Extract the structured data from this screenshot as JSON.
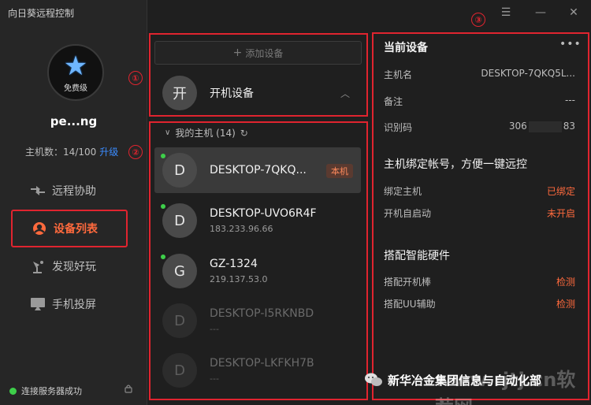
{
  "app": {
    "title": "向日葵远程控制"
  },
  "sidebar": {
    "avatar_tier": "免费级",
    "username": "pe...ng",
    "host_count": "主机数：14/100",
    "upgrade_label": "升级",
    "nav": [
      {
        "label": "远程协助",
        "icon": "remote-assist-icon"
      },
      {
        "label": "设备列表",
        "icon": "device-list-icon"
      },
      {
        "label": "发现好玩",
        "icon": "discover-icon"
      },
      {
        "label": "手机投屏",
        "icon": "screen-cast-icon"
      }
    ],
    "status": "连接服务器成功"
  },
  "badges": [
    "①",
    "②",
    "③"
  ],
  "middle": {
    "add_device": "添加设备",
    "power_device": {
      "avatar": "开",
      "label": "开机设备"
    },
    "group": {
      "label": "我的主机 (14)"
    },
    "devices": [
      {
        "initial": "D",
        "name": "DESKTOP-7QKQ...",
        "ip": "",
        "tag": "本机",
        "online": true
      },
      {
        "initial": "D",
        "name": "DESKTOP-UVO6R4F",
        "ip": "183.233.96.66",
        "online": true
      },
      {
        "initial": "G",
        "name": "GZ-1324",
        "ip": "219.137.53.0",
        "online": true
      },
      {
        "initial": "D",
        "name": "DESKTOP-I5RKNBD",
        "ip": "---",
        "online": false
      },
      {
        "initial": "D",
        "name": "DESKTOP-LKFKH7B",
        "ip": "---",
        "online": false
      }
    ]
  },
  "right": {
    "title": "当前设备",
    "more": "•••",
    "hostname_label": "主机名",
    "hostname_value": "DESKTOP-7QKQ5L...",
    "note_label": "备注",
    "note_value": "---",
    "id_label": "识别码",
    "id_prefix": "306",
    "id_suffix": "83",
    "bind_section": "主机绑定帐号，方便一键远控",
    "bind_host_label": "绑定主机",
    "bind_host_value": "已绑定",
    "autostart_label": "开机自启动",
    "autostart_value": "未开启",
    "hardware_section": "搭配智能硬件",
    "power_stick_label": "搭配开机棒",
    "power_stick_value": "检测",
    "uu_label": "搭配UU辅助",
    "uu_value": "检测"
  },
  "watermark": {
    "url": "www.rjtj.cn软荐网",
    "text": "新华冶金集团信息与自动化部"
  },
  "colors": {
    "accent": "#ff6a3d",
    "annotation_red": "#e0242f",
    "online_green": "#3ecf4a",
    "link_blue": "#3b8cff"
  }
}
